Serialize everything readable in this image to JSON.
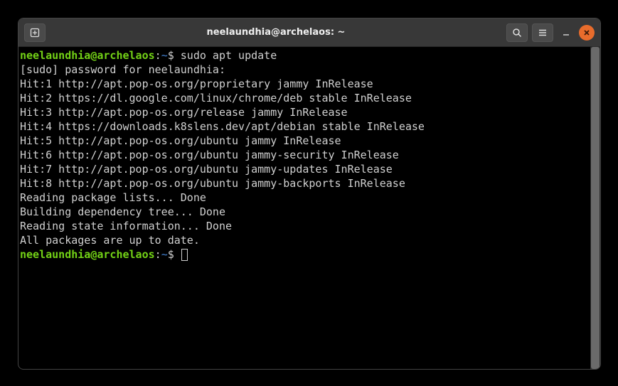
{
  "window": {
    "title": "neelaundhia@archelaos: ~"
  },
  "prompt": {
    "user_host": "neelaundhia@archelaos",
    "colon": ":",
    "path": "~",
    "sigil": "$ "
  },
  "command1": "sudo apt update",
  "output": {
    "line1": "[sudo] password for neelaundhia:",
    "line2": "Hit:1 http://apt.pop-os.org/proprietary jammy InRelease",
    "line3": "",
    "line4": "Hit:2 https://dl.google.com/linux/chrome/deb stable InRelease",
    "line5": "",
    "line6": "Hit:3 http://apt.pop-os.org/release jammy InRelease",
    "line7": "",
    "line8": "Hit:4 https://downloads.k8slens.dev/apt/debian stable InRelease",
    "line9": "Hit:5 http://apt.pop-os.org/ubuntu jammy InRelease",
    "line10": "Hit:6 http://apt.pop-os.org/ubuntu jammy-security InRelease",
    "line11": "Hit:7 http://apt.pop-os.org/ubuntu jammy-updates InRelease",
    "line12": "Hit:8 http://apt.pop-os.org/ubuntu jammy-backports InRelease",
    "line13": "Reading package lists... Done",
    "line14": "Building dependency tree... Done",
    "line15": "Reading state information... Done",
    "line16": "All packages are up to date."
  },
  "icons": {
    "new_tab": "new-tab-icon",
    "search": "search-icon",
    "menu": "hamburger-icon",
    "minimize": "minimize-icon",
    "close": "close-icon"
  }
}
